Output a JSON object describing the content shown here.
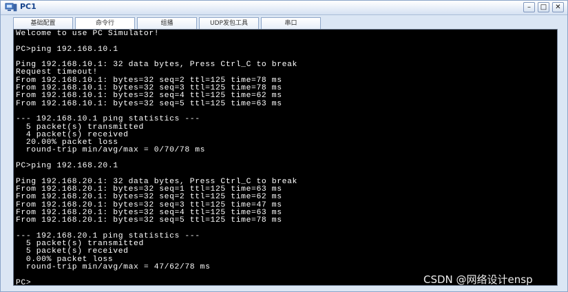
{
  "window": {
    "title": "PC1",
    "minimize_label": "–",
    "maximize_label": "□",
    "close_label": "✕"
  },
  "tabs": [
    {
      "label": "基础配置",
      "active": false
    },
    {
      "label": "命令行",
      "active": true
    },
    {
      "label": "组播",
      "active": false
    },
    {
      "label": "UDP发包工具",
      "active": false
    },
    {
      "label": "串口",
      "active": false
    }
  ],
  "console": {
    "lines": [
      "Welcome to use PC Simulator!",
      "",
      "PC>ping 192.168.10.1",
      "",
      "Ping 192.168.10.1: 32 data bytes, Press Ctrl_C to break",
      "Request timeout!",
      "From 192.168.10.1: bytes=32 seq=2 ttl=125 time=78 ms",
      "From 192.168.10.1: bytes=32 seq=3 ttl=125 time=78 ms",
      "From 192.168.10.1: bytes=32 seq=4 ttl=125 time=62 ms",
      "From 192.168.10.1: bytes=32 seq=5 ttl=125 time=63 ms",
      "",
      "--- 192.168.10.1 ping statistics ---",
      "  5 packet(s) transmitted",
      "  4 packet(s) received",
      "  20.00% packet loss",
      "  round-trip min/avg/max = 0/70/78 ms",
      "",
      "PC>ping 192.168.20.1",
      "",
      "Ping 192.168.20.1: 32 data bytes, Press Ctrl_C to break",
      "From 192.168.20.1: bytes=32 seq=1 ttl=125 time=63 ms",
      "From 192.168.20.1: bytes=32 seq=2 ttl=125 time=62 ms",
      "From 192.168.20.1: bytes=32 seq=3 ttl=125 time=47 ms",
      "From 192.168.20.1: bytes=32 seq=4 ttl=125 time=63 ms",
      "From 192.168.20.1: bytes=32 seq=5 ttl=125 time=78 ms",
      "",
      "--- 192.168.20.1 ping statistics ---",
      "  5 packet(s) transmitted",
      "  5 packet(s) received",
      "  0.00% packet loss",
      "  round-trip min/avg/max = 47/62/78 ms",
      "",
      "PC>"
    ]
  },
  "watermark": "CSDN @网络设计ensp"
}
